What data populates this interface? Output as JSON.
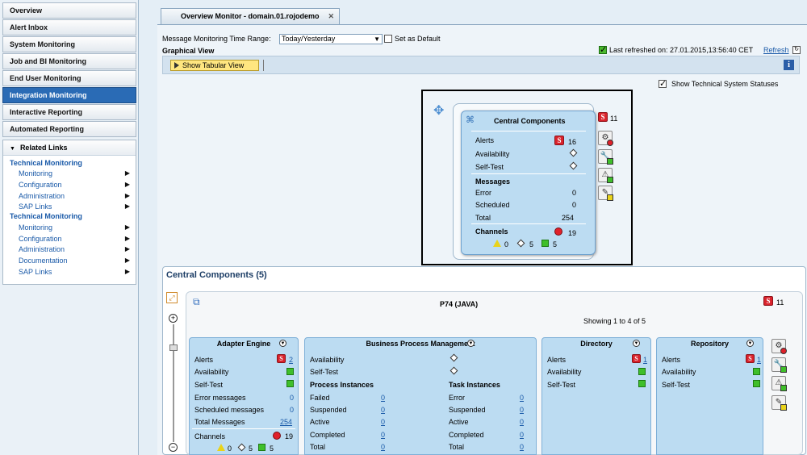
{
  "nav": {
    "items": [
      "Overview",
      "Alert Inbox",
      "System Monitoring",
      "Job and BI Monitoring",
      "End User Monitoring",
      "Integration Monitoring",
      "Interactive Reporting",
      "Automated Reporting"
    ],
    "active_index": 5,
    "related_links_title": "Related Links",
    "groups": [
      {
        "title": "Technical Monitoring",
        "items": [
          "Monitoring",
          "Configuration",
          "Administration",
          "SAP Links"
        ]
      },
      {
        "title": "Technical Monitoring",
        "items": [
          "Monitoring",
          "Configuration",
          "Administration",
          "Documentation",
          "SAP Links"
        ]
      }
    ]
  },
  "tab": {
    "title": "Overview Monitor - domain.01.rojodemo",
    "close": "✕"
  },
  "filters": {
    "time_range_label": "Message Monitoring Time Range:",
    "time_range_value": "Today/Yesterday",
    "set_default_label": "Set as Default",
    "graphical_view_label": "Graphical View",
    "last_refreshed": "Last refreshed on: 27.01.2015,13:56:40 CET",
    "refresh_label": "Refresh",
    "show_tabular_label": "Show Tabular View",
    "show_statuses_label": "Show Technical System Statuses",
    "show_statuses_checked": true
  },
  "graph": {
    "node_title": "Central Components",
    "side_count": "11",
    "alerts_label": "Alerts",
    "alerts_value": "16",
    "availability_label": "Availability",
    "selftest_label": "Self-Test",
    "messages_label": "Messages",
    "error_label": "Error",
    "error_value": "0",
    "scheduled_label": "Scheduled",
    "scheduled_value": "0",
    "total_label": "Total",
    "total_value": "254",
    "channels_label": "Channels",
    "channels_value": "19",
    "ch_yellow": "0",
    "ch_diamond": "5",
    "ch_green": "5"
  },
  "section": {
    "title": "Central Components (5)",
    "system_name": "P74 (JAVA)",
    "system_count": "11",
    "showing": "Showing 1 to 4 of 5"
  },
  "adapter": {
    "title": "Adapter Engine",
    "rows": [
      {
        "label": "Alerts",
        "value": "2"
      },
      {
        "label": "Availability",
        "value": ""
      },
      {
        "label": "Self-Test",
        "value": ""
      },
      {
        "label": "Error messages",
        "value": "0"
      },
      {
        "label": "Scheduled messages",
        "value": "0"
      },
      {
        "label": "Total Messages",
        "value": "254"
      },
      {
        "label": "Channels",
        "value": "19"
      }
    ],
    "ch_yellow": "0",
    "ch_diamond": "5",
    "ch_green": "5"
  },
  "bpm": {
    "title": "Business Process Management",
    "availability_label": "Availability",
    "selftest_label": "Self-Test",
    "process_title": "Process Instances",
    "task_title": "Task Instances",
    "process_rows": [
      {
        "label": "Failed",
        "value": "0"
      },
      {
        "label": "Suspended",
        "value": "0"
      },
      {
        "label": "Active",
        "value": "0"
      },
      {
        "label": "Completed",
        "value": "0"
      },
      {
        "label": "Total",
        "value": "0"
      }
    ],
    "task_rows": [
      {
        "label": "Error",
        "value": "0"
      },
      {
        "label": "Suspended",
        "value": "0"
      },
      {
        "label": "Active",
        "value": "0"
      },
      {
        "label": "Completed",
        "value": "0"
      },
      {
        "label": "Total",
        "value": "0"
      }
    ]
  },
  "directory": {
    "title": "Directory",
    "rows": [
      {
        "label": "Alerts",
        "value": "1"
      },
      {
        "label": "Availability",
        "value": ""
      },
      {
        "label": "Self-Test",
        "value": ""
      }
    ]
  },
  "repository": {
    "title": "Repository",
    "rows": [
      {
        "label": "Alerts",
        "value": "1"
      },
      {
        "label": "Availability",
        "value": ""
      },
      {
        "label": "Self-Test",
        "value": ""
      }
    ]
  },
  "icons": {
    "s_badge": "S",
    "info": "i"
  }
}
